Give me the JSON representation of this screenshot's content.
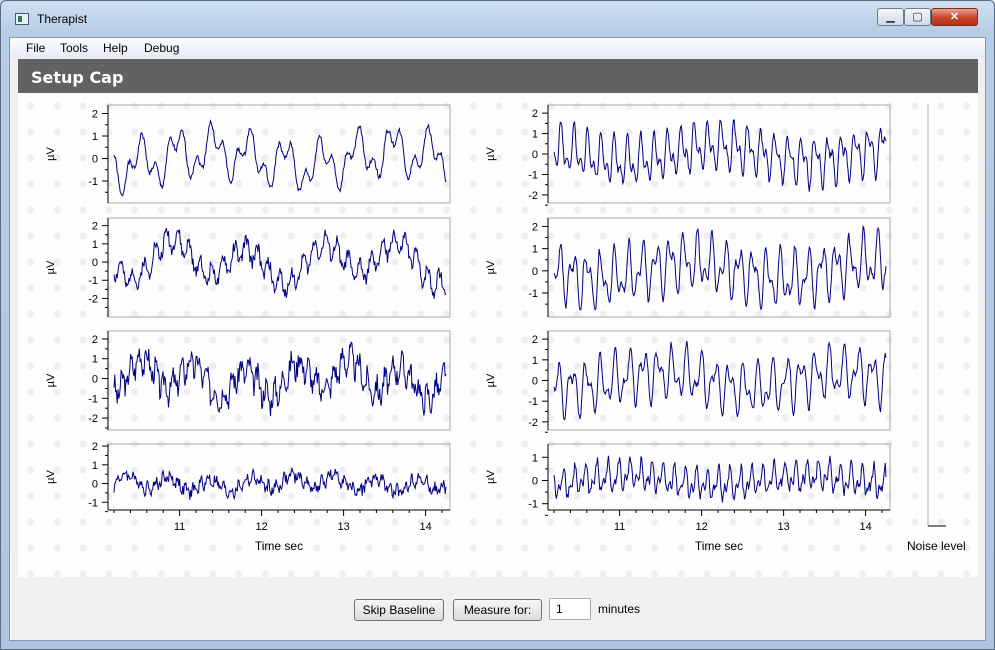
{
  "window": {
    "title": "Therapist",
    "controls": {
      "minimize": "▁",
      "maximize": "▢",
      "close": "✕"
    }
  },
  "menu": [
    "File",
    "Tools",
    "Help",
    "Debug"
  ],
  "header": {
    "title": "Setup Cap"
  },
  "noise_label": "Noise level",
  "controls": {
    "skip_label": "Skip Baseline",
    "measure_label": "Measure for:",
    "minutes_value": "1",
    "minutes_unit": "minutes"
  },
  "colors": {
    "trace": "#000080",
    "header_bg": "#626262",
    "axis": "#000000"
  },
  "chart_data": [
    {
      "type": "line",
      "panel": "left-1",
      "ylabel": "µV",
      "ylim": [
        -1.8,
        2.2
      ],
      "yticks": [
        "2",
        "1",
        "0",
        "-1"
      ],
      "x_range": [
        10.2,
        14.2
      ],
      "signal": {
        "amp": 1.35,
        "f1": 2.3,
        "f2": 6.1,
        "noise": 0.12,
        "seed": 1
      }
    },
    {
      "type": "line",
      "panel": "left-2",
      "ylabel": "µV",
      "ylim": [
        -2.8,
        2.2
      ],
      "yticks": [
        "2",
        "1",
        "0",
        "-1",
        "-2"
      ],
      "x_range": [
        10.2,
        14.2
      ],
      "signal": {
        "amp": 1.5,
        "f1": 1.1,
        "f2": 7.3,
        "noise": 0.35,
        "seed": 2
      }
    },
    {
      "type": "line",
      "panel": "left-3",
      "ylabel": "µV",
      "ylim": [
        -2.4,
        2.2
      ],
      "yticks": [
        "2",
        "1",
        "0",
        "-1",
        "-2"
      ],
      "x_range": [
        10.2,
        14.2
      ],
      "signal": {
        "amp": 1.2,
        "f1": 1.6,
        "f2": 9.8,
        "noise": 0.55,
        "seed": 3
      }
    },
    {
      "type": "line",
      "panel": "left-4",
      "ylabel": "µV",
      "ylim": [
        -1.2,
        1.9
      ],
      "yticks": [
        "2",
        "1",
        "0",
        "-1"
      ],
      "x_range": [
        10.2,
        14.2
      ],
      "xticks": [
        "11",
        "12",
        "13",
        "14"
      ],
      "xlabel": "Time sec",
      "signal": {
        "amp": 0.55,
        "f1": 2.0,
        "f2": 11.0,
        "noise": 0.3,
        "seed": 4
      }
    },
    {
      "type": "line",
      "panel": "right-1",
      "ylabel": "µV",
      "ylim": [
        -2.2,
        2.2
      ],
      "yticks": [
        "2",
        "1",
        "0",
        "-1",
        "-2"
      ],
      "x_range": [
        10.2,
        14.2
      ],
      "signal": {
        "amp": 1.45,
        "f1": 6.2,
        "f2": 12.5,
        "noise": 0.15,
        "seed": 5
      }
    },
    {
      "type": "line",
      "panel": "right-2",
      "ylabel": "µV",
      "ylim": [
        -1.9,
        2.2
      ],
      "yticks": [
        "2",
        "1",
        "0",
        "-1"
      ],
      "x_range": [
        10.2,
        14.2
      ],
      "signal": {
        "amp": 1.55,
        "f1": 6.0,
        "f2": 11.0,
        "noise": 0.15,
        "seed": 6
      }
    },
    {
      "type": "line",
      "panel": "right-3",
      "ylabel": "µV",
      "ylim": [
        -2.2,
        2.2
      ],
      "yticks": [
        "2",
        "1",
        "0",
        "-1",
        "-2"
      ],
      "x_range": [
        10.2,
        14.2
      ],
      "signal": {
        "amp": 1.55,
        "f1": 5.8,
        "f2": 10.5,
        "noise": 0.15,
        "seed": 7
      }
    },
    {
      "type": "line",
      "panel": "right-4",
      "ylabel": "µV",
      "ylim": [
        -1.1,
        1.4
      ],
      "yticks": [
        "1",
        "0",
        "-1"
      ],
      "x_range": [
        10.2,
        14.2
      ],
      "xticks": [
        "11",
        "12",
        "13",
        "14"
      ],
      "xlabel": "Time sec",
      "signal": {
        "amp": 0.8,
        "f1": 7.5,
        "f2": 15.0,
        "noise": 0.2,
        "seed": 8
      }
    }
  ]
}
